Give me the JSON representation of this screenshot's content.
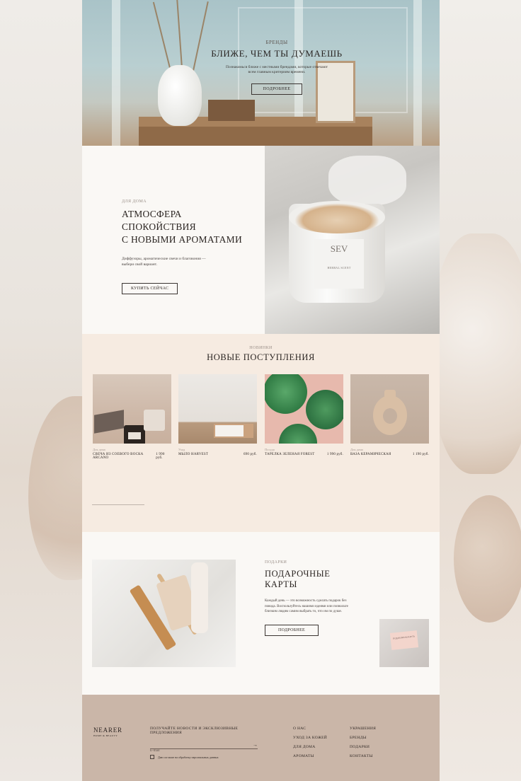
{
  "hero": {
    "eyebrow": "БРЕНДЫ",
    "title": "БЛИЖЕ, ЧЕМ ТЫ ДУМАЕШЬ",
    "description": "Познакомься ближе с местными брендами, которые отвечают всем главным критериям времени.",
    "button": "ПОДРОБНЕЕ"
  },
  "atmosphere": {
    "eyebrow": "ДЛЯ ДОМА",
    "title_line1": "АТМОСФЕРА СПОКОЙСТВИЯ",
    "title_line2": "С НОВЫМИ АРОМАТАМИ",
    "description": "Диффузоры, ароматические свечи и благовония — выбери свой вариант.",
    "button": "КУПИТЬ СЕЙЧАС",
    "candle_brand": "SEV",
    "candle_label": "HERBAL SCENT"
  },
  "arrivals": {
    "eyebrow": "НОВИНКИ",
    "title": "НОВЫЕ ПОСТУПЛЕНИЯ",
    "products": [
      {
        "category": "Для дома",
        "name": "СВЕЧА ИЗ СОЕВОГО ВОСКА ARCANO",
        "price": "1 990 руб."
      },
      {
        "category": "Уход",
        "name": "МЫЛО HARVEST",
        "price": "690 руб."
      },
      {
        "category": "Посуда",
        "name": "ТАРЕЛКА  ЗЕЛЕНАЯ FOREST",
        "price": "1 990 руб."
      },
      {
        "category": "Для дома",
        "name": "ВАЗА КЕРАМИЧЕСКАЯ",
        "price": "1 190 руб."
      }
    ]
  },
  "gifts": {
    "eyebrow": "ПОДАРКИ",
    "title": "ПОДАРОЧНЫЕ КАРТЫ",
    "description": "Каждый день — это возможность сделать подарок без повода. Воспользуйтесь нашими идеями или позвольте близким людям самим выбрать то, что им по душе.",
    "button": "ПОДРОБНЕЕ",
    "card_text": "ПОДАРОЧНАЯ КАРТА"
  },
  "footer": {
    "logo": "NEARER",
    "logo_sub": "HOME & BEAUTY",
    "subscribe_title": "ПОЛУЧАЙТЕ НОВОСТИ И ЭКСКЛЮЗИВНЫЕ ПРЕДЛОЖЕНИЯ",
    "email_placeholder": "E-mail",
    "arrow": "→",
    "consent": "Даю согласие на обработку персональных данных",
    "menu_col1": [
      "О НАС",
      "УХОД ЗА КОЖЕЙ",
      "ДЛЯ ДОМА",
      "АРОМАТЫ"
    ],
    "menu_col2": [
      "УКРАШЕНИЯ",
      "БРЕНДЫ",
      "ПОДАРКИ",
      "КОНТАКТЫ"
    ]
  }
}
